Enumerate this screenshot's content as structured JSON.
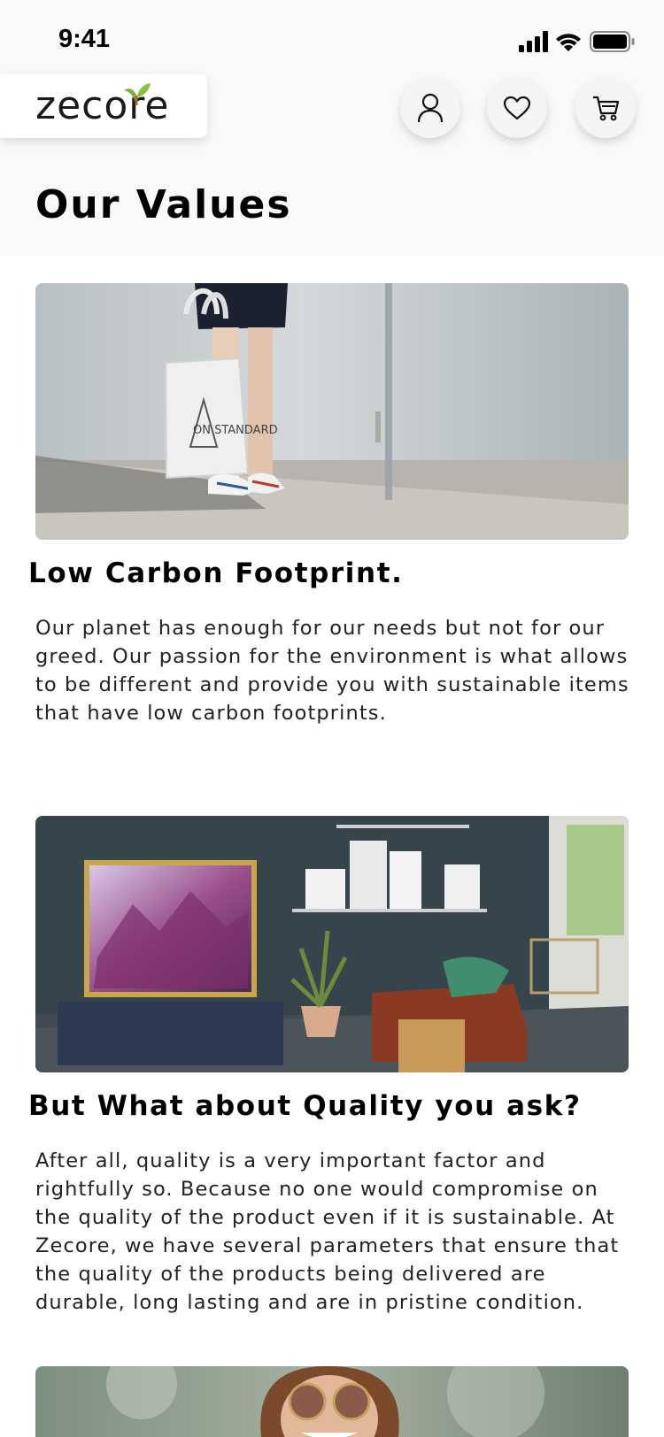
{
  "status_bar": {
    "time": "9:41",
    "icons": [
      "signal-icon",
      "wifi-icon",
      "battery-icon"
    ]
  },
  "header": {
    "logo_text": "zecore",
    "logo_colors": {
      "text": "#1a1a1a",
      "leaf": "#7fae3c"
    },
    "actions": [
      {
        "name": "account-button",
        "icon": "user-icon"
      },
      {
        "name": "wishlist-button",
        "icon": "heart-icon"
      },
      {
        "name": "cart-button",
        "icon": "cart-icon"
      }
    ]
  },
  "page": {
    "title": "Our Values"
  },
  "sections": [
    {
      "image": "tote-bag-photo",
      "heading": "Low Carbon Footprint.",
      "body": "Our planet has enough for our needs but not for our greed. Our passion for the environment is what allows to be different and provide you with sustainable items that have low carbon footprints."
    },
    {
      "image": "living-room-tv-photo",
      "heading": "But What about Quality you ask?",
      "body": "After all, quality is a very important factor and rightfully so. Because no one would compromise on the quality of the product even if it is sustainable. At Zecore, we have several parameters that ensure that the quality of the products being delivered are durable, long lasting and are in pristine condition."
    },
    {
      "image": "woman-sunglasses-photo"
    }
  ],
  "bag_print": "ON STANDARD"
}
